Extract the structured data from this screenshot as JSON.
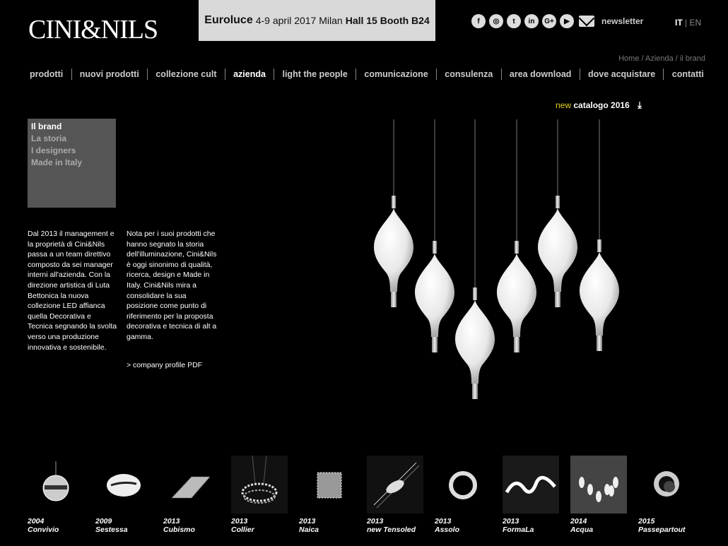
{
  "logo": "CINI&NILS",
  "banner": {
    "title": "Euroluce",
    "dates": "4-9 april 2017 Milan",
    "hall": "Hall 15 Booth B24"
  },
  "social": [
    {
      "icon": "facebook-icon",
      "glyph": "f"
    },
    {
      "icon": "instagram-icon",
      "glyph": "◎"
    },
    {
      "icon": "twitter-icon",
      "glyph": "t"
    },
    {
      "icon": "linkedin-icon",
      "glyph": "in"
    },
    {
      "icon": "googleplus-icon",
      "glyph": "G+"
    },
    {
      "icon": "youtube-icon",
      "glyph": "▶"
    }
  ],
  "newsletter": "newsletter",
  "lang": {
    "it": "IT",
    "sep": "|",
    "en": "EN"
  },
  "breadcrumb": "Home / Azienda / il brand",
  "nav": [
    "prodotti",
    "nuovi prodotti",
    "collezione cult",
    "azienda",
    "light the people",
    "comunicazione",
    "consulenza",
    "area download",
    "dove acquistare",
    "contatti"
  ],
  "nav_active": "azienda",
  "catalog": {
    "new": "new",
    "label": "catalogo 2016",
    "icon": "download-icon"
  },
  "subnav": [
    "Il brand",
    "La storia",
    "I designers",
    "Made in Italy"
  ],
  "text1": "Dal 2013 il management e la proprietà di Cini&Nils passa a un team direttivo composto da sei manager interni all'azienda. Con la direzione artistica di Luta Bettonica la nuova collezione LED affianca quella Decorativa e Tecnica segnando la svolta verso una produzione innovativa e sostenibile.",
  "text2": "Nota per i suoi prodotti che hanno segnato la storia dell'illuminazione, Cini&Nils è oggi sinonimo di qualità, ricerca, design e Made in Italy. Cini&Nils mira a consolidare la sua posizione come punto di riferimento per la proposta decorativa e tecnica di alt a gamma.",
  "pdf_link": "> company profile PDF",
  "products": [
    {
      "year": "2004",
      "name": "Convivio"
    },
    {
      "year": "2009",
      "name": "Sestessa"
    },
    {
      "year": "2013",
      "name": "Cubismo"
    },
    {
      "year": "2013",
      "name": "Collier"
    },
    {
      "year": "2013",
      "name": "Naica"
    },
    {
      "year": "2013",
      "name": "new Tensoled"
    },
    {
      "year": "2013",
      "name": "Assolo"
    },
    {
      "year": "2013",
      "name": "FormaLa"
    },
    {
      "year": "2014",
      "name": "Acqua"
    },
    {
      "year": "2015",
      "name": "Passepartout"
    }
  ]
}
